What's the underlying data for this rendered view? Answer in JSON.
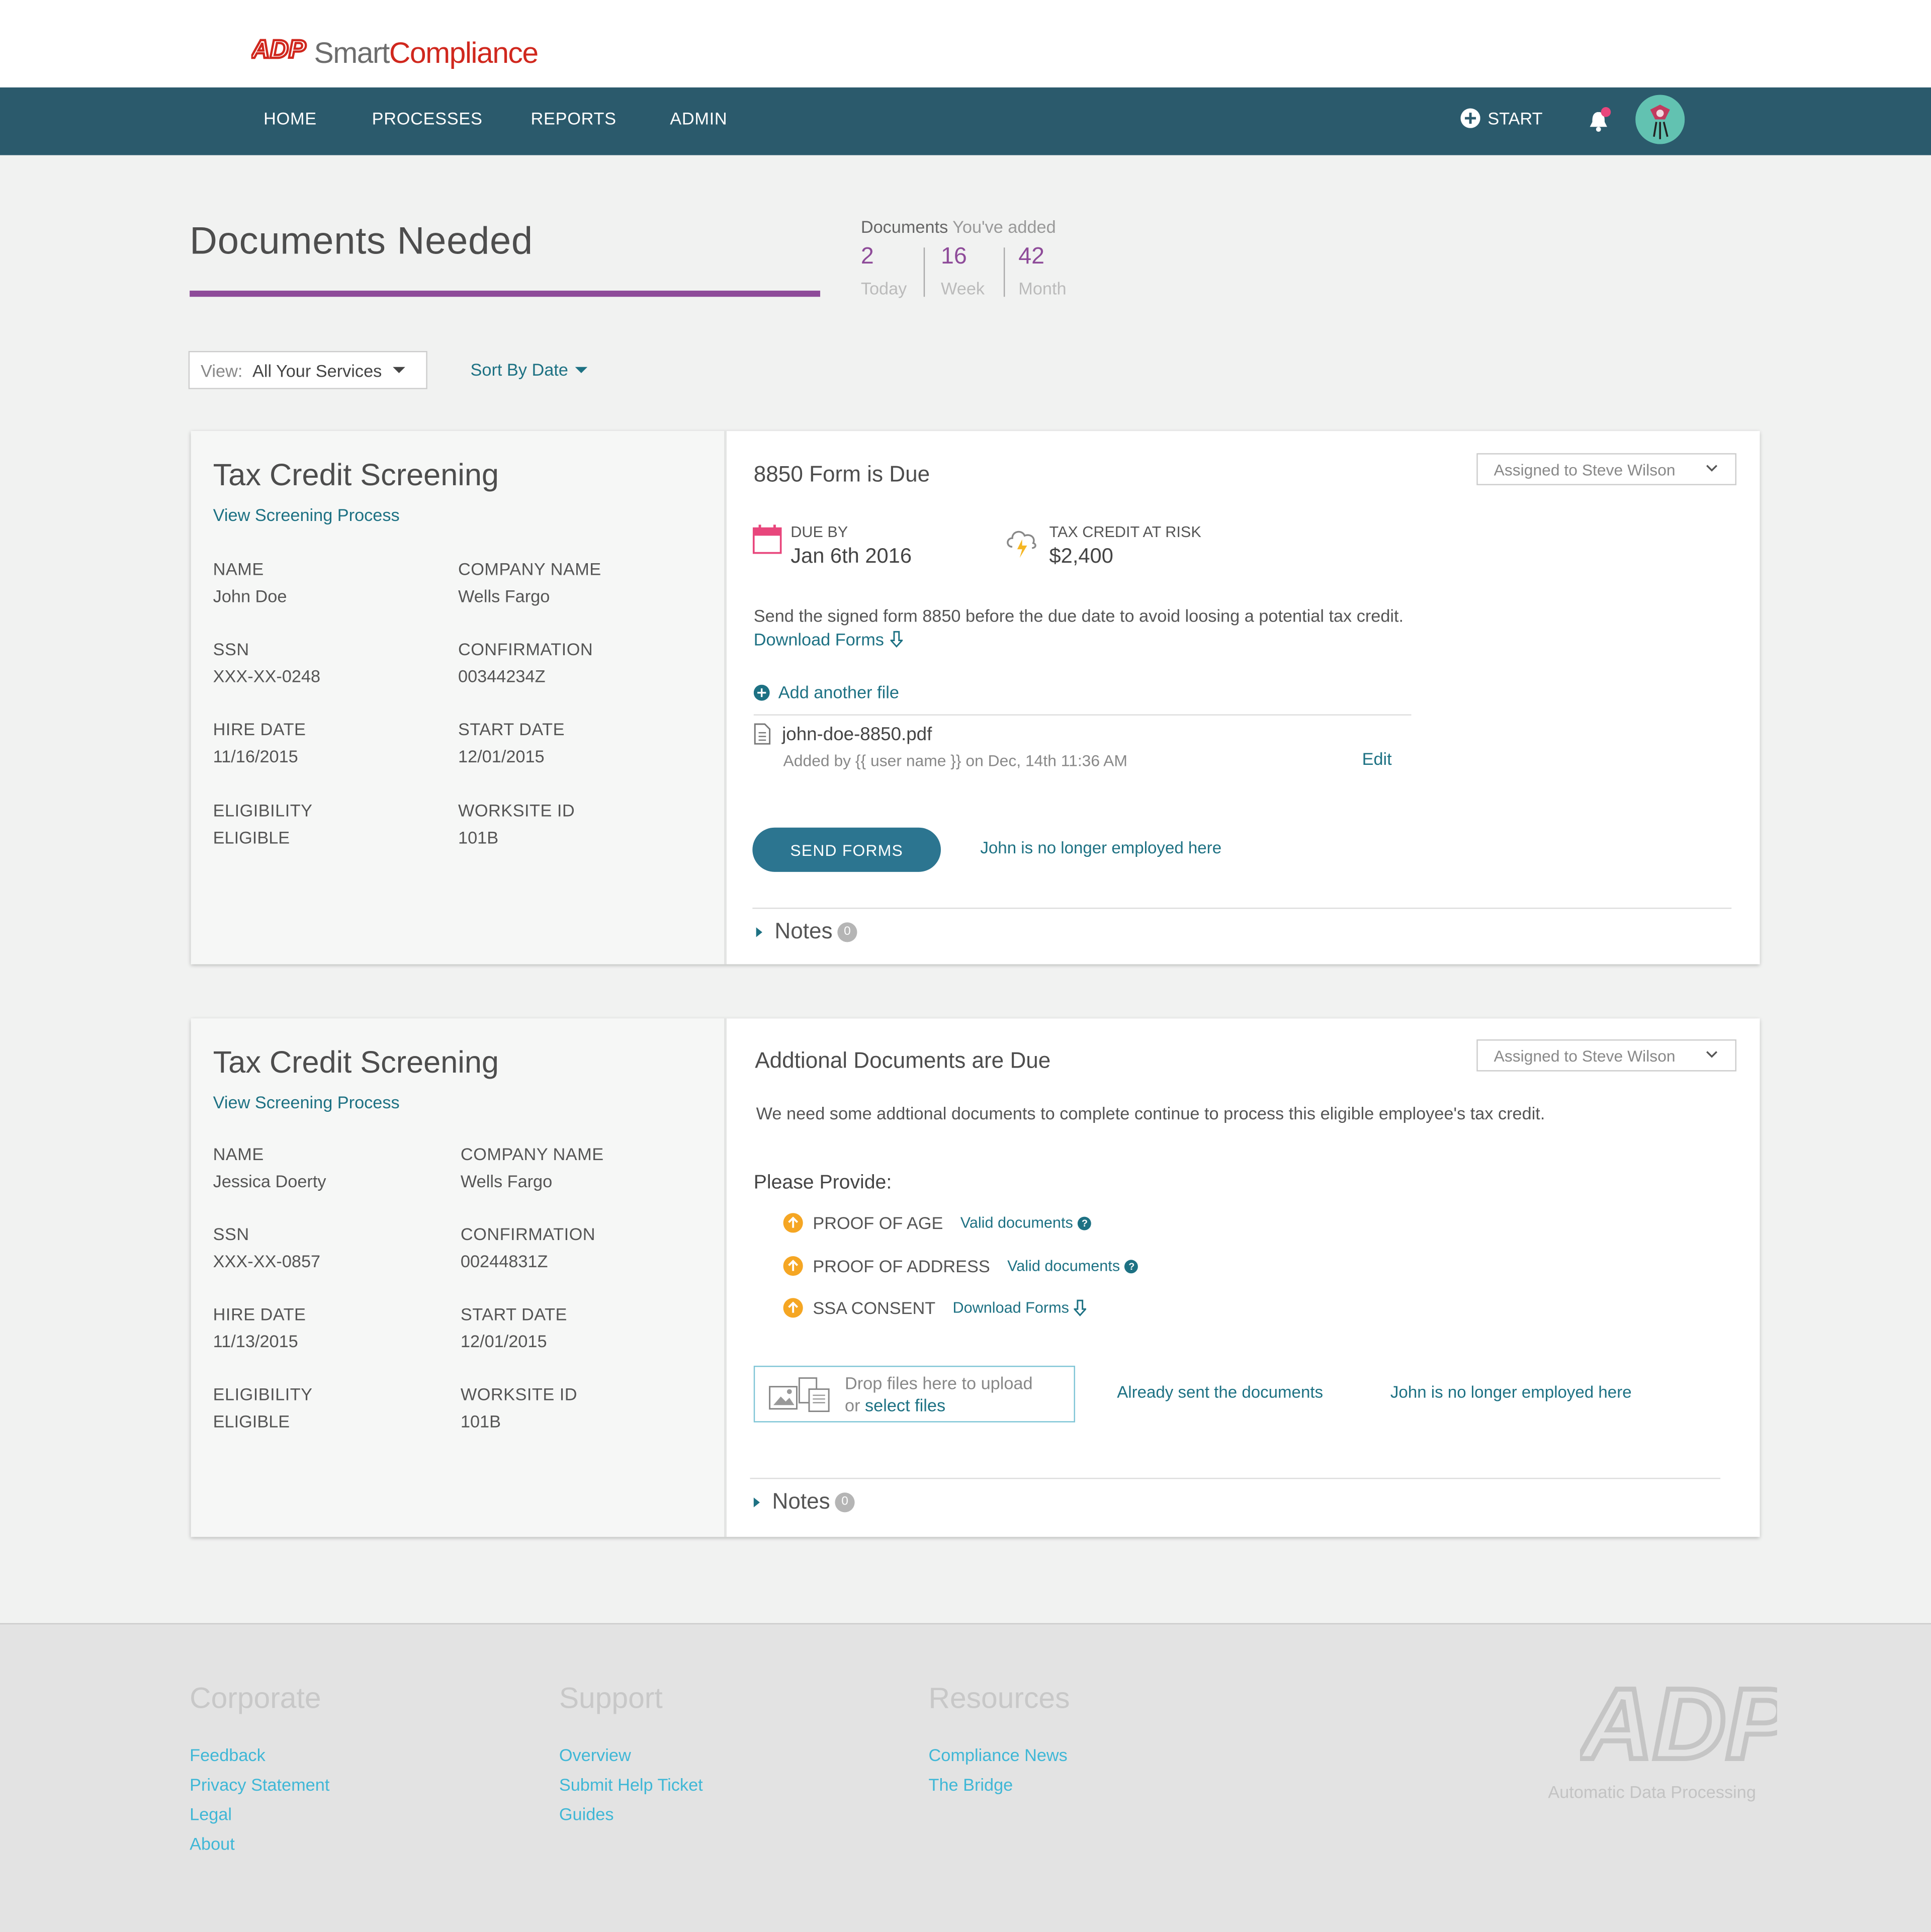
{
  "brand": {
    "mark": "ADP",
    "name_part1": "Smart",
    "name_part2": "Compliance"
  },
  "nav": {
    "items": [
      "HOME",
      "PROCESSES",
      "REPORTS",
      "ADMIN"
    ],
    "start_label": "START"
  },
  "page": {
    "title": "Documents Needed"
  },
  "docs_added": {
    "heading_bold": "Documents",
    "heading_rest": "You've added",
    "stats": [
      {
        "value": "2",
        "unit": "Today"
      },
      {
        "value": "16",
        "unit": "Week"
      },
      {
        "value": "42",
        "unit": "Month"
      }
    ]
  },
  "filters": {
    "view_prefix": "View:",
    "view_value": "All Your Services",
    "sort_label": "Sort By Date"
  },
  "cards": [
    {
      "title": "Tax Credit Screening",
      "link": "View Screening Process",
      "fields": [
        {
          "label": "NAME",
          "value": "John Doe"
        },
        {
          "label": "COMPANY NAME",
          "value": "Wells Fargo"
        },
        {
          "label": "SSN",
          "value": "XXX-XX-0248"
        },
        {
          "label": "CONFIRMATION",
          "value": "00344234Z"
        },
        {
          "label": "HIRE DATE",
          "value": "11/16/2015"
        },
        {
          "label": "START DATE",
          "value": "12/01/2015"
        },
        {
          "label": "ELIGIBILITY",
          "value": "ELIGIBLE"
        },
        {
          "label": "WORKSITE ID",
          "value": "101B"
        }
      ],
      "section_title": "8850 Form is Due",
      "assigned": "Assigned to Steve Wilson",
      "due_label": "DUE BY",
      "due_value": "Jan 6th 2016",
      "risk_label": "TAX CREDIT AT RISK",
      "risk_value": "$2,400",
      "description": "Send the signed form 8850 before the due date to avoid loosing a potential tax credit.",
      "download_label": "Download Forms",
      "add_file_label": "Add another file",
      "file_name": "john-doe-8850.pdf",
      "file_meta": "Added by {{ user name }} on Dec, 14th 11:36 AM",
      "edit_label": "Edit",
      "send_label": "SEND FORMS",
      "not_employed": "John is no longer employed here",
      "notes_label": "Notes",
      "notes_count": "0"
    },
    {
      "title": "Tax Credit Screening",
      "link": "View Screening Process",
      "fields": [
        {
          "label": "NAME",
          "value": "Jessica Doerty"
        },
        {
          "label": "COMPANY NAME",
          "value": "Wells Fargo"
        },
        {
          "label": "SSN",
          "value": "XXX-XX-0857"
        },
        {
          "label": "CONFIRMATION",
          "value": "00244831Z"
        },
        {
          "label": "HIRE DATE",
          "value": "11/13/2015"
        },
        {
          "label": "START DATE",
          "value": "12/01/2015"
        },
        {
          "label": "ELIGIBILITY",
          "value": "ELIGIBLE"
        },
        {
          "label": "WORKSITE ID",
          "value": "101B"
        }
      ],
      "section_title": "Addtional Documents are Due",
      "assigned": "Assigned to Steve Wilson",
      "description": "We need some addtional documents to complete continue to process this eligible employee's tax credit.",
      "provide_label": "Please Provide:",
      "requirements": [
        {
          "label": "PROOF OF AGE",
          "link": "Valid documents"
        },
        {
          "label": "PROOF OF ADDRESS",
          "link": "Valid documents"
        },
        {
          "label": "SSA CONSENT",
          "link": "Download Forms"
        }
      ],
      "drop_text": "Drop files here to upload",
      "drop_or": "or",
      "drop_select": "select files",
      "already_sent": "Already sent the documents",
      "not_employed": "John is no longer employed here",
      "notes_label": "Notes",
      "notes_count": "0"
    }
  ],
  "footer": {
    "columns": [
      {
        "heading": "Corporate",
        "links": [
          "Feedback",
          "Privacy Statement",
          "Legal",
          "About"
        ]
      },
      {
        "heading": "Support",
        "links": [
          "Overview",
          "Submit Help Ticket",
          "Guides"
        ]
      },
      {
        "heading": "Resources",
        "links": [
          "Compliance News",
          "The Bridge"
        ]
      }
    ],
    "logo_mark": "ADP",
    "tagline": "Automatic Data Processing"
  },
  "colors": {
    "nav": "#2b5a6c",
    "accent": "#8e4b99",
    "link": "#1d7183",
    "brand_red": "#d0271d",
    "warning": "#f5a623"
  }
}
